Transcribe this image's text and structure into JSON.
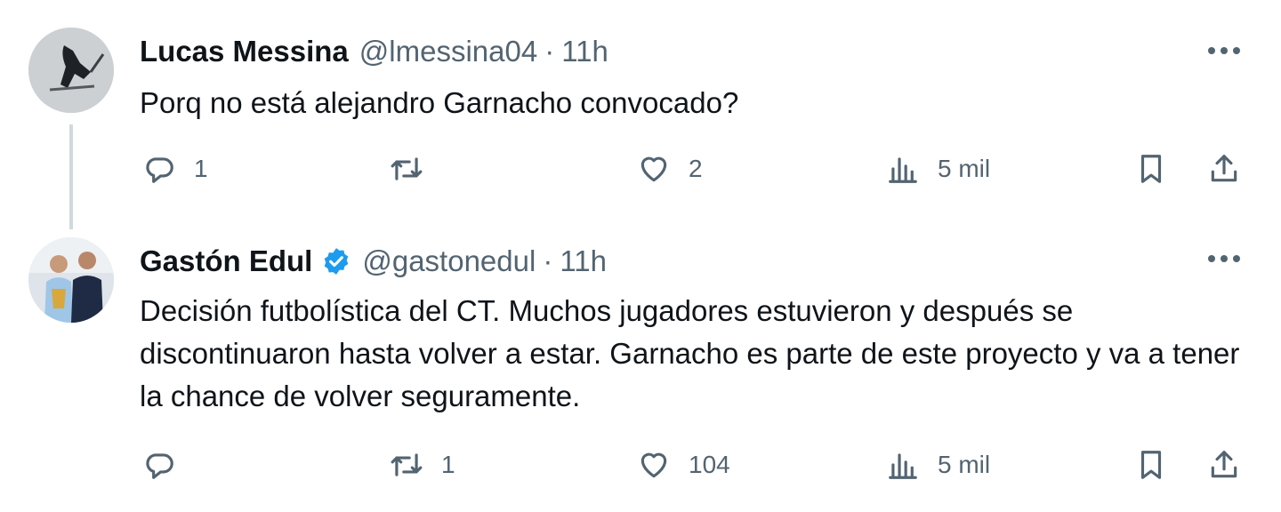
{
  "tweets": [
    {
      "name": "Lucas Messina",
      "handle": "@lmessina04",
      "separator": "·",
      "time": "11h",
      "text": "Porq no está alejandro Garnacho convocado?",
      "replies": "1",
      "retweets": "",
      "likes": "2",
      "views": "5 mil",
      "verified": false
    },
    {
      "name": "Gastón Edul",
      "handle": "@gastonedul",
      "separator": "·",
      "time": "11h",
      "text": "Decisión futbolística del CT. Muchos jugadores estuvieron y después se discontinuaron hasta volver a estar. Garnacho es parte de este proyecto y va a tener la chance de volver seguramente.",
      "replies": "",
      "retweets": "1",
      "likes": "104",
      "views": "5 mil",
      "verified": true
    }
  ],
  "colors": {
    "text": "#0f1419",
    "secondary": "#536471",
    "verified": "#1d9bf0",
    "thread_line": "#cfd9de"
  },
  "icons": [
    "reply-icon",
    "retweet-icon",
    "like-icon",
    "views-icon",
    "bookmark-icon",
    "share-icon",
    "more-icon",
    "verified-badge-icon"
  ]
}
